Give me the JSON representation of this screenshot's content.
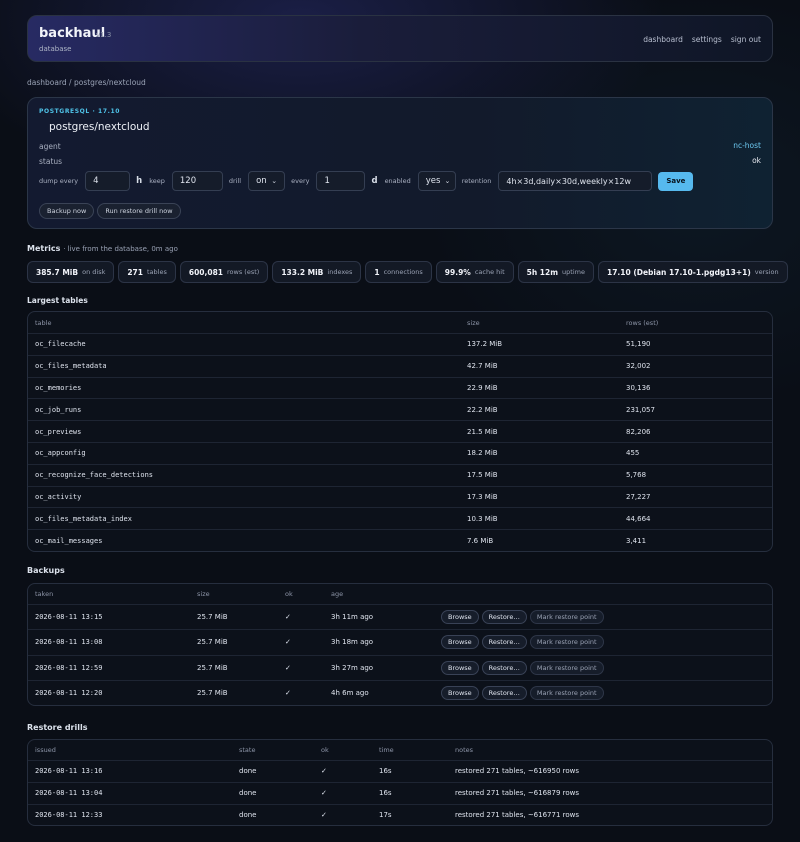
{
  "header": {
    "brand": "backhaul",
    "version": "v1.3",
    "subtitle": "database",
    "nav": [
      "dashboard",
      "settings",
      "sign out"
    ]
  },
  "breadcrumb": "dashboard / postgres/nextcloud",
  "database": {
    "engine": "POSTGRESQL · 17.10",
    "name": "postgres/nextcloud",
    "agent_label": "agent",
    "agent_value": "nc-host",
    "status_label": "status",
    "status_value": "ok",
    "form": {
      "dump_every_label": "dump every",
      "dump_every_value": "4",
      "dump_every_unit": "h",
      "keep_label": "keep",
      "keep_value": "120",
      "drill_label": "drill",
      "drill_value": "on",
      "every_label": "every",
      "every_value": "1",
      "every_unit": "d",
      "enabled_label": "enabled",
      "enabled_value": "yes",
      "retention_label": "retention",
      "retention_value": "4h×3d,daily×30d,weekly×12w",
      "save_label": "Save"
    },
    "actions": [
      "Backup now",
      "Run restore drill now"
    ]
  },
  "metrics": {
    "title": "Metrics",
    "subtitle": "· live from the database, 0m ago",
    "items": [
      {
        "value": "385.7 MiB",
        "label": "on disk"
      },
      {
        "value": "271",
        "label": "tables"
      },
      {
        "value": "600,081",
        "label": "rows (est)"
      },
      {
        "value": "133.2 MiB",
        "label": "indexes"
      },
      {
        "value": "1",
        "label": "connections"
      },
      {
        "value": "99.9%",
        "label": "cache hit"
      },
      {
        "value": "5h 12m",
        "label": "uptime"
      },
      {
        "value": "17.10 (Debian 17.10-1.pgdg13+1)",
        "label": "version"
      }
    ]
  },
  "largest_tables": {
    "title": "Largest tables",
    "columns": [
      "table",
      "size",
      "rows (est)"
    ],
    "rows": [
      [
        "oc_filecache",
        "137.2 MiB",
        "51,190"
      ],
      [
        "oc_files_metadata",
        "42.7 MiB",
        "32,002"
      ],
      [
        "oc_memories",
        "22.9 MiB",
        "30,136"
      ],
      [
        "oc_job_runs",
        "22.2 MiB",
        "231,057"
      ],
      [
        "oc_previews",
        "21.5 MiB",
        "82,206"
      ],
      [
        "oc_appconfig",
        "18.2 MiB",
        "455"
      ],
      [
        "oc_recognize_face_detections",
        "17.5 MiB",
        "5,768"
      ],
      [
        "oc_activity",
        "17.3 MiB",
        "27,227"
      ],
      [
        "oc_files_metadata_index",
        "10.3 MiB",
        "44,664"
      ],
      [
        "oc_mail_messages",
        "7.6 MiB",
        "3,411"
      ]
    ]
  },
  "backups": {
    "title": "Backups",
    "columns": [
      "taken",
      "size",
      "ok",
      "age"
    ],
    "actions": [
      "Browse",
      "Restore…",
      "Mark restore point"
    ],
    "rows": [
      [
        "2026-08-11 13:15",
        "25.7 MiB",
        "✓",
        "3h 11m ago"
      ],
      [
        "2026-08-11 13:08",
        "25.7 MiB",
        "✓",
        "3h 18m ago"
      ],
      [
        "2026-08-11 12:59",
        "25.7 MiB",
        "✓",
        "3h 27m ago"
      ],
      [
        "2026-08-11 12:20",
        "25.7 MiB",
        "✓",
        "4h 6m ago"
      ]
    ]
  },
  "restore_drills": {
    "title": "Restore drills",
    "columns": [
      "issued",
      "state",
      "ok",
      "time",
      "notes"
    ],
    "rows": [
      [
        "2026-08-11 13:16",
        "done",
        "✓",
        "16s",
        "restored 271 tables, ~616950 rows"
      ],
      [
        "2026-08-11 13:04",
        "done",
        "✓",
        "16s",
        "restored 271 tables, ~616879 rows"
      ],
      [
        "2026-08-11 12:33",
        "done",
        "✓",
        "17s",
        "restored 271 tables, ~616771 rows"
      ]
    ]
  }
}
